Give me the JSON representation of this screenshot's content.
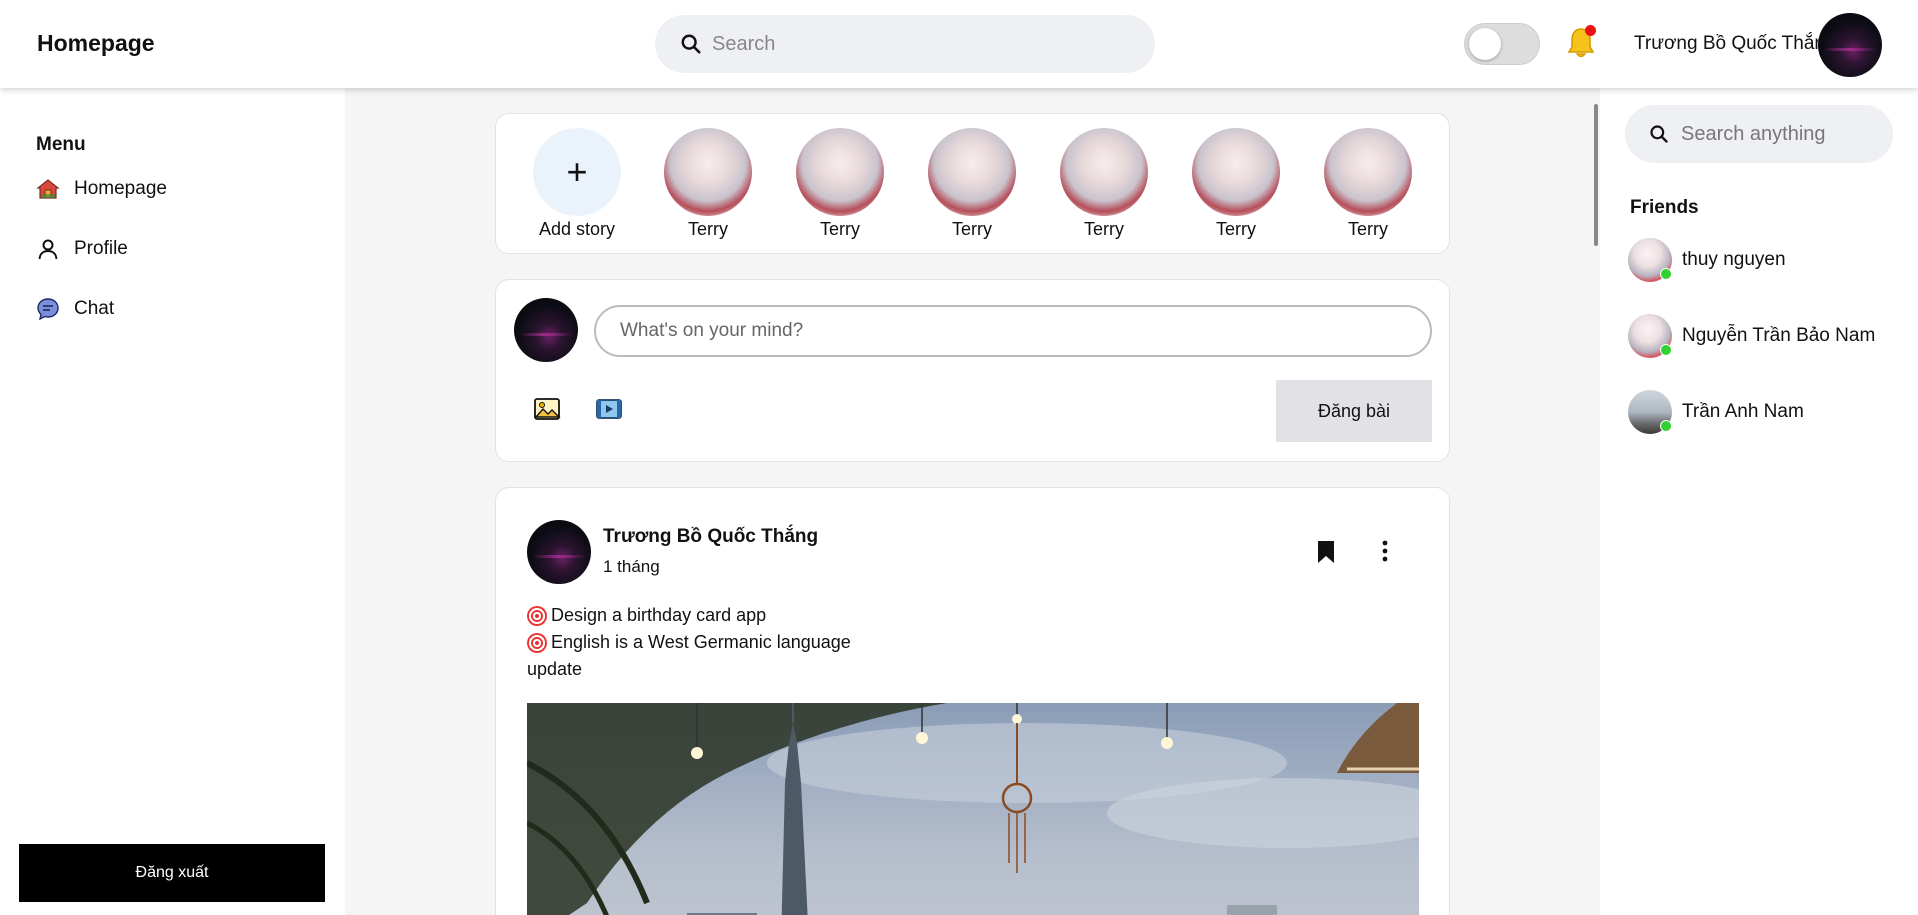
{
  "header": {
    "brand": "Homepage",
    "search_placeholder": "Search",
    "user_name": "Trương Bồ Quốc Thắng"
  },
  "menu": {
    "title": "Menu",
    "items": [
      {
        "label": "Homepage",
        "icon": "home-icon"
      },
      {
        "label": "Profile",
        "icon": "user-icon"
      },
      {
        "label": "Chat",
        "icon": "chat-icon"
      }
    ],
    "logout_label": "Đăng xuất"
  },
  "stories": {
    "add_label": "Add story",
    "items": [
      {
        "name": "Terry"
      },
      {
        "name": "Terry"
      },
      {
        "name": "Terry"
      },
      {
        "name": "Terry"
      },
      {
        "name": "Terry"
      },
      {
        "name": "Terry"
      }
    ]
  },
  "composer": {
    "placeholder": "What's on your mind?",
    "post_label": "Đăng bài",
    "tools": [
      "image-icon",
      "video-icon"
    ]
  },
  "post": {
    "author": "Trương Bồ Quốc Thắng",
    "time": "1 tháng",
    "lines": [
      "Design a birthday card app",
      "English is a West Germanic language",
      "update"
    ]
  },
  "right": {
    "search_placeholder": "Search anything",
    "friends_title": "Friends",
    "friends": [
      {
        "name": "thuy nguyen",
        "online": true
      },
      {
        "name": "Nguyễn Trần Bảo Nam",
        "online": true
      },
      {
        "name": "Trần Anh Nam",
        "online": true
      }
    ]
  },
  "colors": {
    "online": "#2fd22f",
    "notification_dot": "#e11111",
    "logout_bg": "#000000"
  }
}
